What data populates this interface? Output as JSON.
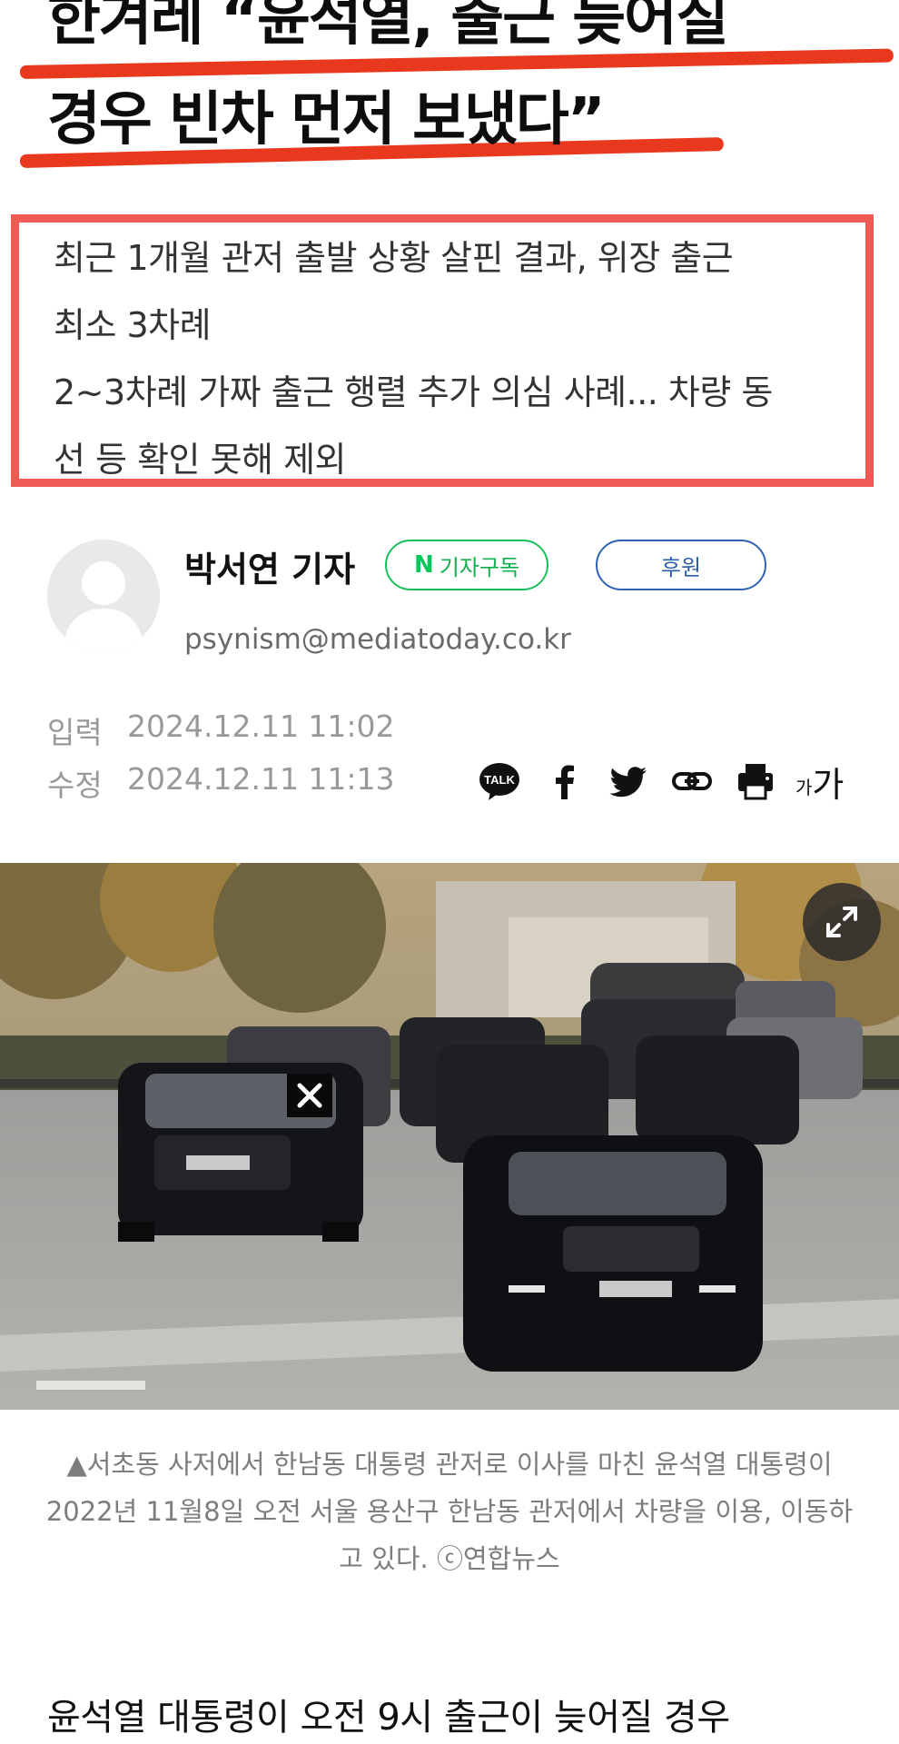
{
  "article": {
    "title_lines": [
      "한겨레 “윤석열, 출근 늦어질",
      "경우 빈차 먼저 보냈다”"
    ],
    "subtitle_lines": [
      "최근 1개월 관저 출발 상황 살핀 결과, 위장 출근",
      "최소 3차례",
      "2~3차례 가짜 출근 행렬 추가 의심 사례... 차량 동",
      "선 등 확인 못해 제외"
    ],
    "body_first_line": "윤석열 대통령이 오전 9시 출근이 늦어질 경우"
  },
  "author": {
    "name": "박서연 기자",
    "email": "psynism@mediatoday.co.kr",
    "subscribe_logo": "N",
    "subscribe_label": "기자구독",
    "support_label": "후원"
  },
  "meta": {
    "input_label": "입력",
    "input_value": "2024.12.11 11:02",
    "modified_label": "수정",
    "modified_value": "2024.12.11 11:13"
  },
  "share": {
    "talk_label": "TALK",
    "font_small": "가",
    "font_large": "가",
    "icons": [
      "kakaotalk-icon",
      "facebook-icon",
      "twitter-icon",
      "link-icon",
      "print-icon",
      "font-size-icon"
    ]
  },
  "photo": {
    "caption": "▲서초동 사저에서 한남동 대통령 관저로 이사를 마친 윤석열 대통령이 2022년 11월8일 오전 서울 용산구 한남동 관저에서 차량을 이용, 이동하고 있다. ⓒ연합뉴스"
  },
  "colors": {
    "accent_red": "#e8391e",
    "box_border": "#ef5b54",
    "naver_green": "#03c75a",
    "support_blue": "#2f64b4"
  }
}
